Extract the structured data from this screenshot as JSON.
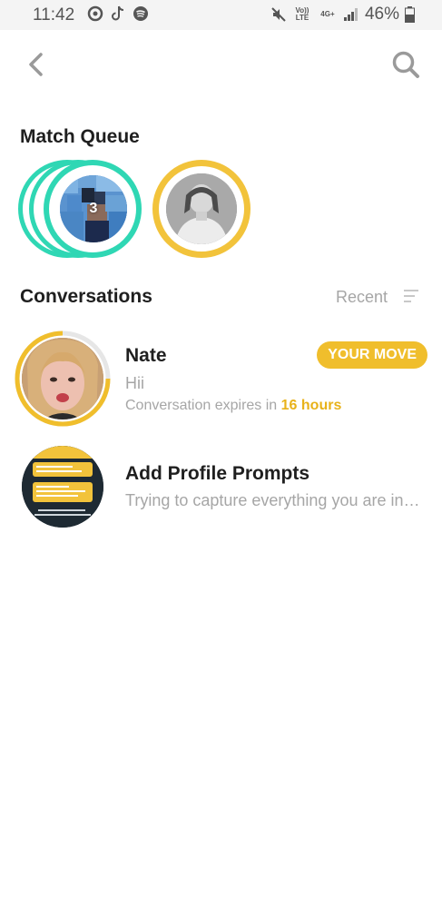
{
  "status_bar": {
    "time": "11:42",
    "volte": "Vo)) LTE",
    "network": "4G+",
    "battery_percent": "46%",
    "icons": [
      "whatsapp-like-icon",
      "tiktok-icon",
      "spotify-icon",
      "mute-icon",
      "volte-icon",
      "4g-icon",
      "signal-icon",
      "battery-icon"
    ]
  },
  "nav": {
    "back_icon": "chevron-left-icon",
    "search_icon": "search-icon"
  },
  "match_queue": {
    "title": "Match Queue",
    "stack_count": "3",
    "stack_ring_color": "#2fd7b4",
    "single_ring_color": "#f2c33b"
  },
  "conversations": {
    "title": "Conversations",
    "sort_label": "Recent",
    "items": [
      {
        "name": "Nate",
        "message": "Hii",
        "expires_prefix": "Conversation expires in",
        "expires_value": "16 hours",
        "badge": "YOUR MOVE"
      },
      {
        "name": "Add Profile Prompts",
        "message": "Trying to capture everything you are in…"
      }
    ]
  },
  "colors": {
    "accent_yellow": "#f0be2c",
    "teal": "#2fd7b4",
    "muted_text": "#a6a6a6"
  }
}
